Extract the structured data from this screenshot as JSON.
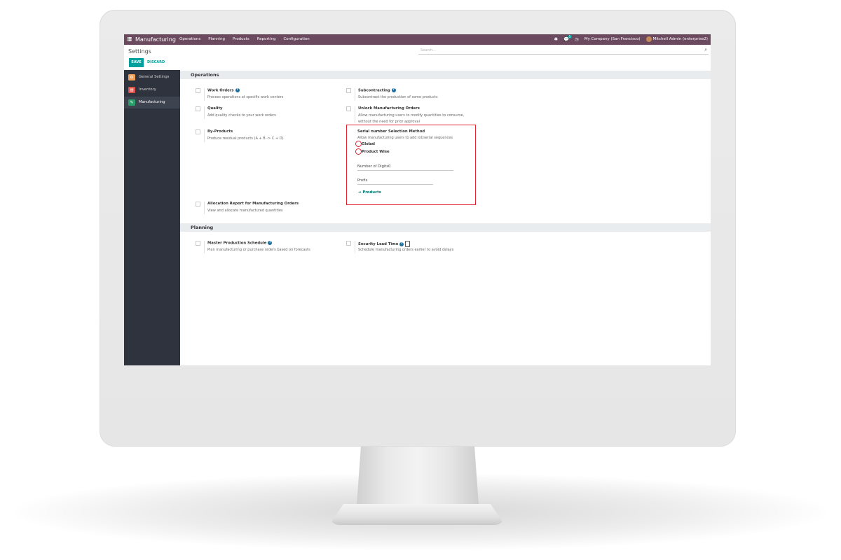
{
  "navbar": {
    "app_name": "Manufacturing",
    "menu": [
      "Operations",
      "Planning",
      "Products",
      "Reporting",
      "Configuration"
    ],
    "messages_count": "5",
    "company": "My Company (San Francisco)",
    "user": "Mitchell Admin (enterprise2)"
  },
  "control_panel": {
    "title": "Settings",
    "search_placeholder": "Search...",
    "save_label": "SAVE",
    "discard_label": "DISCARD"
  },
  "sidebar": {
    "items": [
      {
        "label": "General Settings",
        "color": "#f0a15a"
      },
      {
        "label": "Inventory",
        "color": "#e0524a"
      },
      {
        "label": "Manufacturing",
        "color": "#2a9d68"
      }
    ]
  },
  "operations": {
    "heading": "Operations",
    "work_orders": {
      "title": "Work Orders",
      "desc": "Process operations at specific work centers"
    },
    "subcontracting": {
      "title": "Subcontracting",
      "desc": "Subcontract the production of some products"
    },
    "quality": {
      "title": "Quality",
      "desc": "Add quality checks to your work orders"
    },
    "unlock": {
      "title": "Unlock Manufacturing Orders",
      "desc1": "Allow manufacturing users to modify quantities to consume,",
      "desc2": "without the need for prior approval"
    },
    "by_products": {
      "title": "By-Products",
      "desc": "Produce residual products (A + B -> C + D)"
    },
    "serial": {
      "title": "Serial number Selection Method",
      "desc": "Allow manufacturing users to add lot/serial sequences",
      "option_global": "Global",
      "option_product": "Product Wise",
      "digits_label": "Number of Digits",
      "digits_value": "0",
      "prefix_label": "Prefix",
      "products_link": "Products"
    },
    "allocation": {
      "title": "Allocation Report for Manufacturing Orders",
      "desc": "View and allocate manufactured quantities"
    }
  },
  "planning": {
    "heading": "Planning",
    "mps": {
      "title": "Master Production Schedule",
      "desc": "Plan manufacturing or purchase orders based on forecasts"
    },
    "security": {
      "title": "Security Lead Time",
      "desc": "Schedule manufacturing orders earlier to avoid delays"
    }
  },
  "colors": {
    "navbar": "#6b4a60",
    "accent": "#00a09d",
    "highlight": "#e0242f",
    "sidebar": "#2f333e"
  }
}
